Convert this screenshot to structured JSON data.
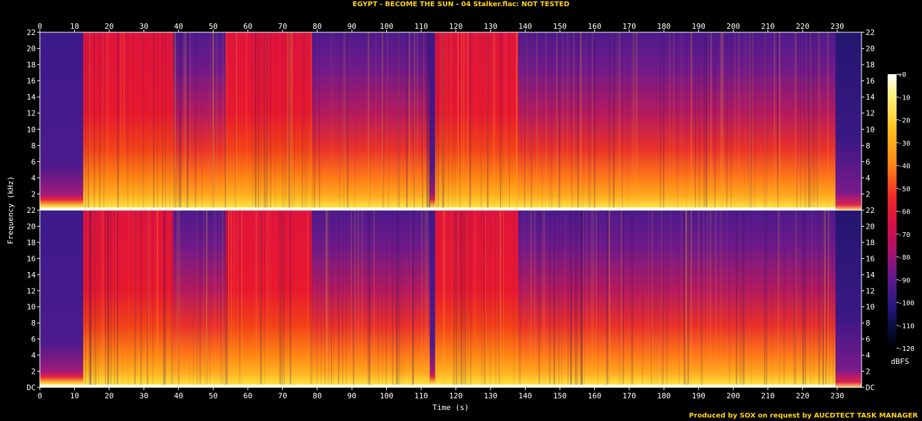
{
  "title": "EGYPT - BECOME THE SUN - 04 Stalker.flac: NOT TESTED",
  "footer": "Produced by SOX on request by AUCDTECT TASK MANAGER",
  "colors": {
    "accent_text": "#ffd21a",
    "background": "#000000",
    "axis": "#ffffff"
  },
  "chart_data": {
    "type": "heatmap",
    "title": "EGYPT - BECOME THE SUN - 04 Stalker.flac: NOT TESTED",
    "xlabel": "Time (s)",
    "ylabel": "Frequency (kHz)",
    "x_ticks": [
      "0",
      "10",
      "20",
      "30",
      "40",
      "50",
      "60",
      "70",
      "80",
      "90",
      "100",
      "110",
      "120",
      "130",
      "140",
      "150",
      "160",
      "170",
      "180",
      "190",
      "200",
      "210",
      "220",
      "230"
    ],
    "y_ticks": [
      "DC",
      "2",
      "4",
      "6",
      "8",
      "10",
      "12",
      "14",
      "16",
      "18",
      "20",
      "22"
    ],
    "xlim": [
      0,
      237
    ],
    "ylim": [
      0,
      22
    ],
    "channels": 2,
    "colorbar": {
      "label": "dBFS",
      "ticks": [
        "+0",
        "-10",
        "-20",
        "-30",
        "-40",
        "-50",
        "-60",
        "-70",
        "-80",
        "-90",
        "-100",
        "-110",
        "-120"
      ],
      "range": [
        -120,
        0
      ]
    },
    "segments": [
      {
        "start": 0,
        "end": 12.5,
        "level": "quiet",
        "bandwidth_khz": 2
      },
      {
        "start": 12.5,
        "end": 38.5,
        "level": "loud",
        "bandwidth_khz": 22
      },
      {
        "start": 38.5,
        "end": 53.5,
        "level": "medium",
        "bandwidth_khz": 18
      },
      {
        "start": 53.5,
        "end": 78.5,
        "level": "loud",
        "bandwidth_khz": 22
      },
      {
        "start": 78.5,
        "end": 112.5,
        "level": "medium",
        "bandwidth_khz": 18
      },
      {
        "start": 112.5,
        "end": 114,
        "level": "quiet",
        "bandwidth_khz": 4
      },
      {
        "start": 114,
        "end": 138,
        "level": "loud",
        "bandwidth_khz": 22
      },
      {
        "start": 138,
        "end": 229.5,
        "level": "medium",
        "bandwidth_khz": 20
      },
      {
        "start": 229.5,
        "end": 237,
        "level": "fade",
        "bandwidth_khz": 4
      }
    ]
  }
}
